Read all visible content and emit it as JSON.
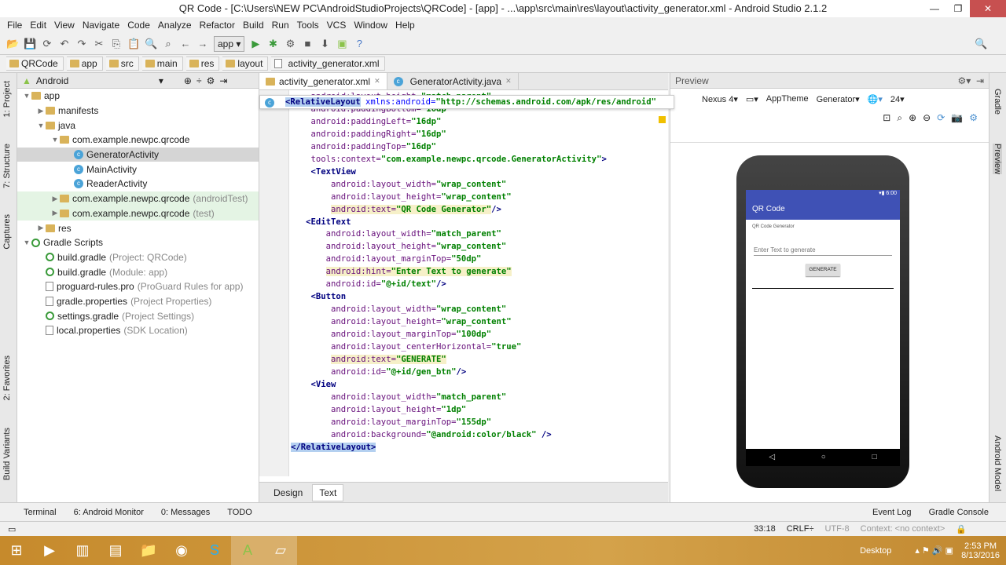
{
  "window": {
    "title": "QR Code - [C:\\Users\\NEW PC\\AndroidStudioProjects\\QRCode] - [app] - ...\\app\\src\\main\\res\\layout\\activity_generator.xml - Android Studio 2.1.2",
    "min": "—",
    "max": "❐",
    "close": "✕"
  },
  "menu": [
    "File",
    "Edit",
    "View",
    "Navigate",
    "Code",
    "Analyze",
    "Refactor",
    "Build",
    "Run",
    "Tools",
    "VCS",
    "Window",
    "Help"
  ],
  "toolbar": {
    "run_config": "app ▾"
  },
  "breadcrumbs": [
    "QRCode",
    "app",
    "src",
    "main",
    "res",
    "layout",
    "activity_generator.xml"
  ],
  "left_strip": [
    "1: Project",
    "7: Structure",
    "Captures",
    "2: Favorites",
    "Build Variants"
  ],
  "right_strip": [
    "Gradle",
    "Preview",
    "Android Model"
  ],
  "project": {
    "view": "Android",
    "tree": [
      {
        "label": "app",
        "level": 0,
        "arrow": "▼",
        "icon": "folder"
      },
      {
        "label": "manifests",
        "level": 1,
        "arrow": "▶",
        "icon": "folder"
      },
      {
        "label": "java",
        "level": 1,
        "arrow": "▼",
        "icon": "folder"
      },
      {
        "label": "com.example.newpc.qrcode",
        "level": 2,
        "arrow": "▼",
        "icon": "folder"
      },
      {
        "label": "GeneratorActivity",
        "level": 3,
        "arrow": "",
        "icon": "class",
        "selected": true
      },
      {
        "label": "MainActivity",
        "level": 3,
        "arrow": "",
        "icon": "class"
      },
      {
        "label": "ReaderActivity",
        "level": 3,
        "arrow": "",
        "icon": "class"
      },
      {
        "label": "com.example.newpc.qrcode",
        "dim": "(androidTest)",
        "level": 2,
        "arrow": "▶",
        "icon": "folder",
        "test": true
      },
      {
        "label": "com.example.newpc.qrcode",
        "dim": "(test)",
        "level": 2,
        "arrow": "▶",
        "icon": "folder",
        "test": true
      },
      {
        "label": "res",
        "level": 1,
        "arrow": "▶",
        "icon": "folder"
      },
      {
        "label": "Gradle Scripts",
        "level": 0,
        "arrow": "▼",
        "icon": "gradle"
      },
      {
        "label": "build.gradle",
        "dim": "(Project: QRCode)",
        "level": 1,
        "arrow": "",
        "icon": "gradle"
      },
      {
        "label": "build.gradle",
        "dim": "(Module: app)",
        "level": 1,
        "arrow": "",
        "icon": "gradle"
      },
      {
        "label": "proguard-rules.pro",
        "dim": "(ProGuard Rules for app)",
        "level": 1,
        "arrow": "",
        "icon": "file"
      },
      {
        "label": "gradle.properties",
        "dim": "(Project Properties)",
        "level": 1,
        "arrow": "",
        "icon": "file"
      },
      {
        "label": "settings.gradle",
        "dim": "(Project Settings)",
        "level": 1,
        "arrow": "",
        "icon": "gradle"
      },
      {
        "label": "local.properties",
        "dim": "(SDK Location)",
        "level": 1,
        "arrow": "",
        "icon": "file"
      }
    ]
  },
  "editor": {
    "tabs": [
      {
        "label": "activity_generator.xml",
        "active": true
      },
      {
        "label": "GeneratorActivity.java",
        "active": false
      }
    ],
    "sticky": {
      "tag": "<RelativeLayout",
      "attr": " xmlns:android=",
      "val": "\"http://schemas.android.com/apk/res/android\""
    },
    "lines": [
      {
        "ind": "    ",
        "a": "android:layout_height=",
        "v": "\"match_parent\""
      },
      {
        "ind": "    ",
        "a": "android:paddingBottom=",
        "v": "\"16dp\""
      },
      {
        "ind": "    ",
        "a": "android:paddingLeft=",
        "v": "\"16dp\""
      },
      {
        "ind": "    ",
        "a": "android:paddingRight=",
        "v": "\"16dp\""
      },
      {
        "ind": "    ",
        "a": "android:paddingTop=",
        "v": "\"16dp\""
      },
      {
        "ind": "    ",
        "a": "tools:context=",
        "v": "\"com.example.newpc.qrcode.GeneratorActivity\"",
        "e": ">"
      },
      {
        "ind": "    ",
        "t": "<TextView"
      },
      {
        "ind": "        ",
        "a": "android:layout_width=",
        "v": "\"wrap_content\""
      },
      {
        "ind": "        ",
        "a": "android:layout_height=",
        "v": "\"wrap_content\""
      },
      {
        "ind": "        ",
        "a": "android:text=",
        "v": "\"QR Code Generator\"",
        "e": "/>",
        "hl": true
      },
      {
        "ind": "   ",
        "t": "<EditText"
      },
      {
        "ind": "       ",
        "a": "android:layout_width=",
        "v": "\"match_parent\""
      },
      {
        "ind": "       ",
        "a": "android:layout_height=",
        "v": "\"wrap_content\""
      },
      {
        "ind": "       ",
        "a": "android:layout_marginTop=",
        "v": "\"50dp\""
      },
      {
        "ind": "       ",
        "a": "android:hint=",
        "v": "\"Enter Text to generate\"",
        "hl": true
      },
      {
        "ind": "       ",
        "a": "android:id=",
        "v": "\"@+id/text\"",
        "e": "/>"
      },
      {
        "ind": "    ",
        "t": "<Button"
      },
      {
        "ind": "        ",
        "a": "android:layout_width=",
        "v": "\"wrap_content\""
      },
      {
        "ind": "        ",
        "a": "android:layout_height=",
        "v": "\"wrap_content\""
      },
      {
        "ind": "        ",
        "a": "android:layout_marginTop=",
        "v": "\"100dp\""
      },
      {
        "ind": "        ",
        "a": "android:layout_centerHorizontal=",
        "v": "\"true\""
      },
      {
        "ind": "        ",
        "a": "android:text=",
        "v": "\"GENERATE\"",
        "hl": true
      },
      {
        "ind": "        ",
        "a": "android:id=",
        "v": "\"@+id/gen_btn\"",
        "e": "/>"
      },
      {
        "ind": "    ",
        "t": "<View"
      },
      {
        "ind": "        ",
        "a": "android:layout_width=",
        "v": "\"match_parent\""
      },
      {
        "ind": "        ",
        "a": "android:layout_height=",
        "v": "\"1dp\""
      },
      {
        "ind": "        ",
        "a": "android:layout_marginTop=",
        "v": "\"155dp\""
      },
      {
        "ind": "        ",
        "a": "android:background=",
        "v": "\"@android:color/black\"",
        "e": " />"
      },
      {
        "ind": "",
        "t": "</RelativeLayout>",
        "sel": true
      }
    ],
    "bottom_tabs": [
      "Design",
      "Text"
    ]
  },
  "preview": {
    "title": "Preview",
    "device": "Nexus 4▾",
    "theme": "AppTheme",
    "activity": "Generator▾",
    "api": "24▾",
    "phone": {
      "time": "▾▮ 6:00",
      "app_title": "QR Code",
      "label": "QR Code Generator",
      "hint": "Enter Text to generate",
      "button": "GENERATE",
      "nav": [
        "◁",
        "○",
        "□"
      ]
    }
  },
  "bottom_tools": [
    "Terminal",
    "6: Android Monitor",
    "0: Messages",
    "TODO"
  ],
  "bottom_tools_right": [
    "Event Log",
    "Gradle Console"
  ],
  "status": {
    "pos": "33:18",
    "eol": "CRLF÷",
    "enc": "UTF-8",
    "context": "Context: <no context>"
  },
  "taskbar": {
    "desktop": "Desktop",
    "time": "2:53 PM",
    "date": "8/13/2016"
  }
}
